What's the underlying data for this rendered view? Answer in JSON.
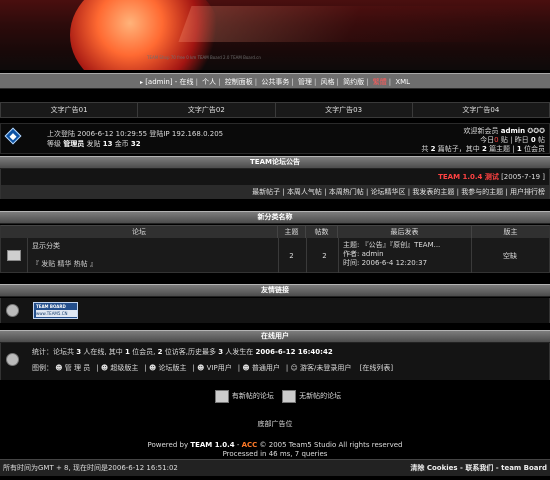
{
  "banner": {
    "ticker": "TEAM Shop 70 free 0 km TEAM Board 2.0 TEAM Board.cn"
  },
  "nav": {
    "items": [
      "[admin] - 在线",
      "个人",
      "控制面板",
      "公共事务",
      "管理",
      "风格",
      "简约版",
      "繁體",
      "XML"
    ]
  },
  "ads": [
    "文字广告01",
    "文字广告02",
    "文字广告03",
    "文字广告04"
  ],
  "user": {
    "last_login_label": "上次登陆",
    "last_login": "2006-6-12 10:29:55",
    "ip_label": "登陆IP",
    "ip": "192.168.0.205",
    "level_label": "等级",
    "level": "管理员",
    "posts_label": "发贴",
    "posts": "13",
    "coins_label": "金币",
    "coins": "32",
    "welcome": "欢迎新会员",
    "new_member": "admin",
    "stars": "✪✪✪",
    "today_prefix": "今日",
    "today_count": "0",
    "today_mid": "贴 | 昨日",
    "yesterday_count": "0",
    "today_suffix": "帖",
    "totals_a": "共",
    "total_posts": "2",
    "totals_b": "篇帖子，其中",
    "total_topics": "2",
    "totals_c": "篇主题 |",
    "total_members": "1",
    "totals_d": "位会员"
  },
  "announce": {
    "title": "TEAM论坛公告",
    "text": "TEAM 1.0.4 测试",
    "date": "[2005-7-19 ]"
  },
  "tools": [
    "最新帖子",
    "本周人气帖",
    "本周热门帖",
    "论坛精华区",
    "我发表的主题",
    "我参与的主题",
    "用户排行榜"
  ],
  "category": {
    "title": "新分类名称",
    "columns": [
      "论坛",
      "主题",
      "帖数",
      "最后发表",
      "版主"
    ],
    "forums": [
      {
        "name": "显示分类",
        "subs": "『 发贴 精华 热帖 』",
        "topics": "2",
        "posts": "2",
        "last_title": "主题: 『公告』『原创』TEAM...",
        "last_author": "作者: admin",
        "last_time": "时间: 2006-6-4 12:20:37",
        "moderator": "空缺"
      }
    ]
  },
  "links": {
    "title": "友情链接",
    "logo_top": "TEAM BOARD",
    "logo_bottom": "www.TEAM5.CN"
  },
  "online": {
    "title": "在线用户",
    "stats_a": "统计：论坛共",
    "stats_total": "3",
    "stats_b": "人在线, 其中",
    "stats_members": "1",
    "stats_c": "位会员,",
    "stats_guests": "2",
    "stats_d": "位访客,历史最多",
    "stats_max": "3",
    "stats_e": "人发生在",
    "stats_time": "2006-6-12 16:40:42",
    "legend_label": "图例：",
    "legend": [
      "管 理 员",
      "超级版主",
      "论坛版主",
      "VIP用户",
      "普通用户",
      "游客/未登录用户"
    ],
    "list_link": "[在线列表]"
  },
  "legend": {
    "new": "有新帖的论坛",
    "no_new": "无新帖的论坛"
  },
  "footer": {
    "ad": "底部广告位",
    "powered_a": "Powered by ",
    "powered_team": "TEAM 1.0.4",
    "powered_b": " - ",
    "powered_acc": "ACC",
    "powered_c": " © 2005 Team5 Studio All rights reserved",
    "processed": "Processed in 46 ms, 7 queries",
    "time_left": "所有时间为GMT + 8, 现在时间是2006-6-12 16:51:02",
    "right_links": "清除 Cookies - 联系我们 - team Board"
  },
  "colors": {
    "accent": "#ff4242",
    "acc": "#ff7a28",
    "header_bar": "#6e6e6e"
  }
}
